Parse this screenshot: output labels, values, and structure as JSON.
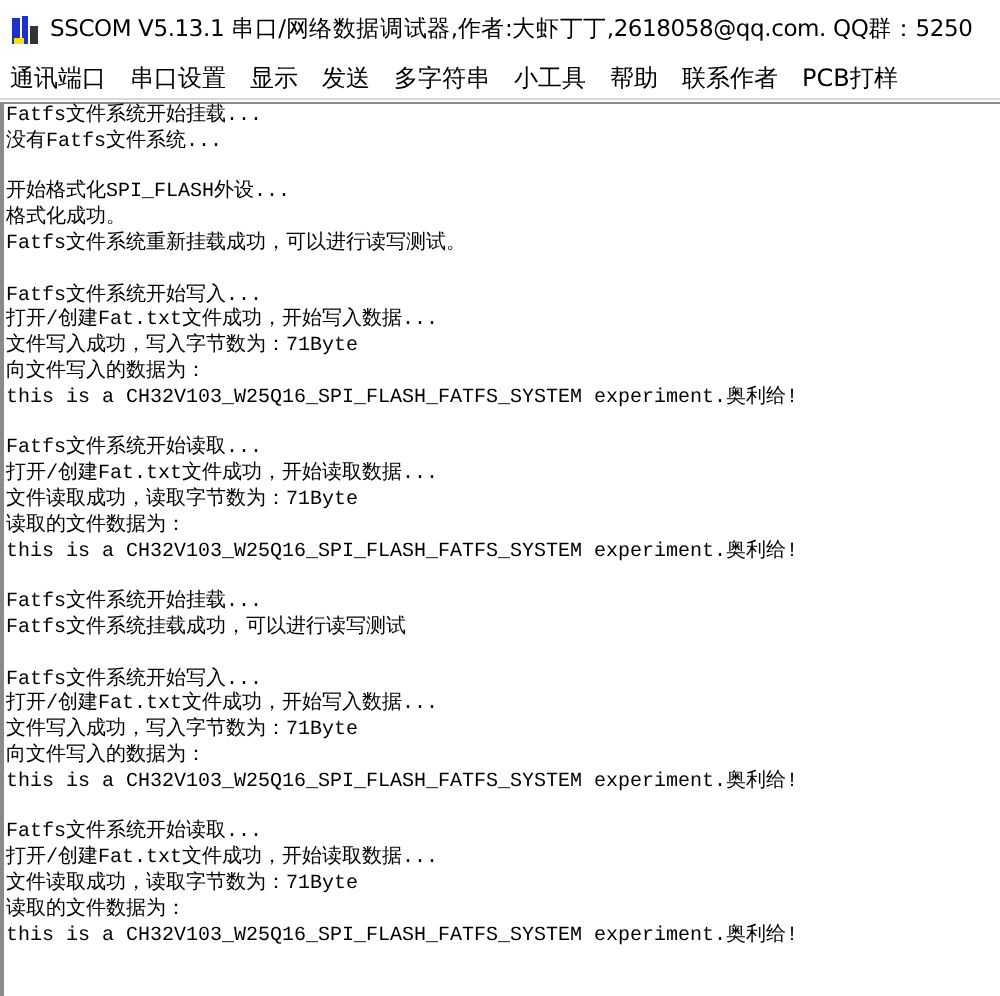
{
  "window": {
    "title": "SSCOM V5.13.1 串口/网络数据调试器,作者:大虾丁丁,2618058@qq.com. QQ群：5250"
  },
  "menu": [
    "通讯端口",
    "串口设置",
    "显示",
    "发送",
    "多字符串",
    "小工具",
    "帮助",
    "联系作者",
    "PCB打样"
  ],
  "receive_area": {
    "blocks": [
      [
        "Fatfs文件系统开始挂载...",
        "没有Fatfs文件系统..."
      ],
      [
        "开始格式化SPI_FLASH外设...",
        "格式化成功。",
        "Fatfs文件系统重新挂载成功，可以进行读写测试。"
      ],
      [
        "Fatfs文件系统开始写入...",
        "打开/创建Fat.txt文件成功，开始写入数据...",
        "文件写入成功，写入字节数为：71Byte",
        "向文件写入的数据为：",
        "this is a CH32V103_W25Q16_SPI_FLASH_FATFS_SYSTEM experiment.奥利给!"
      ],
      [
        "Fatfs文件系统开始读取...",
        "打开/创建Fat.txt文件成功，开始读取数据...",
        "文件读取成功，读取字节数为：71Byte",
        "读取的文件数据为：",
        "this is a CH32V103_W25Q16_SPI_FLASH_FATFS_SYSTEM experiment.奥利给!"
      ],
      [
        "Fatfs文件系统开始挂载...",
        "Fatfs文件系统挂载成功，可以进行读写测试"
      ],
      [
        "Fatfs文件系统开始写入...",
        "打开/创建Fat.txt文件成功，开始写入数据...",
        "文件写入成功，写入字节数为：71Byte",
        "向文件写入的数据为：",
        "this is a CH32V103_W25Q16_SPI_FLASH_FATFS_SYSTEM experiment.奥利给!"
      ],
      [
        "Fatfs文件系统开始读取...",
        "打开/创建Fat.txt文件成功，开始读取数据...",
        "文件读取成功，读取字节数为：71Byte",
        "读取的文件数据为：",
        "this is a CH32V103_W25Q16_SPI_FLASH_FATFS_SYSTEM experiment.奥利给!"
      ]
    ]
  }
}
